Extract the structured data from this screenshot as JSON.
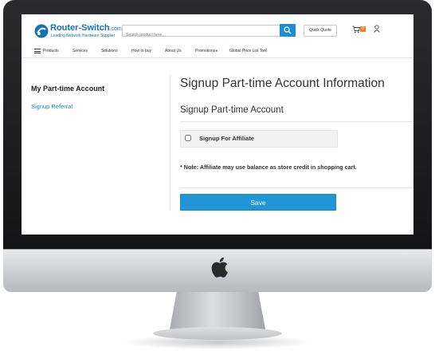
{
  "header": {
    "logo_name": "Router-Switch",
    "logo_suffix": ".com",
    "logo_tagline": "Leading Network Hardware Supplier",
    "search_placeholder": "Search product here...",
    "quick_quote_label": "Quick Quote",
    "cart_count": "0"
  },
  "nav": {
    "items": [
      {
        "label": "Products"
      },
      {
        "label": "Services"
      },
      {
        "label": "Solutions"
      },
      {
        "label": "How to buy"
      },
      {
        "label": "About Us"
      },
      {
        "label": "Promotions"
      },
      {
        "label": "Global Price List Tool"
      }
    ],
    "hot_marker": "●"
  },
  "sidebar": {
    "title": "My Part-time Account",
    "items": [
      {
        "label": "Signup Referral"
      }
    ]
  },
  "main": {
    "title": "Signup Part-time Account Information",
    "section_title": "Signup Part-time Account",
    "checkbox_label": "Signup For Affiliate",
    "checkbox_checked": false,
    "note": "* Note: Affiliate may use balance as store credit in shopping cart.",
    "save_label": "Save"
  },
  "colors": {
    "accent": "#2196d6",
    "link": "#1d83c9",
    "cart_badge": "#f47c20"
  },
  "icons": [
    "apple-logo-icon",
    "search-icon",
    "cart-icon",
    "user-icon",
    "menu-icon",
    "router-switch-logo-icon"
  ]
}
